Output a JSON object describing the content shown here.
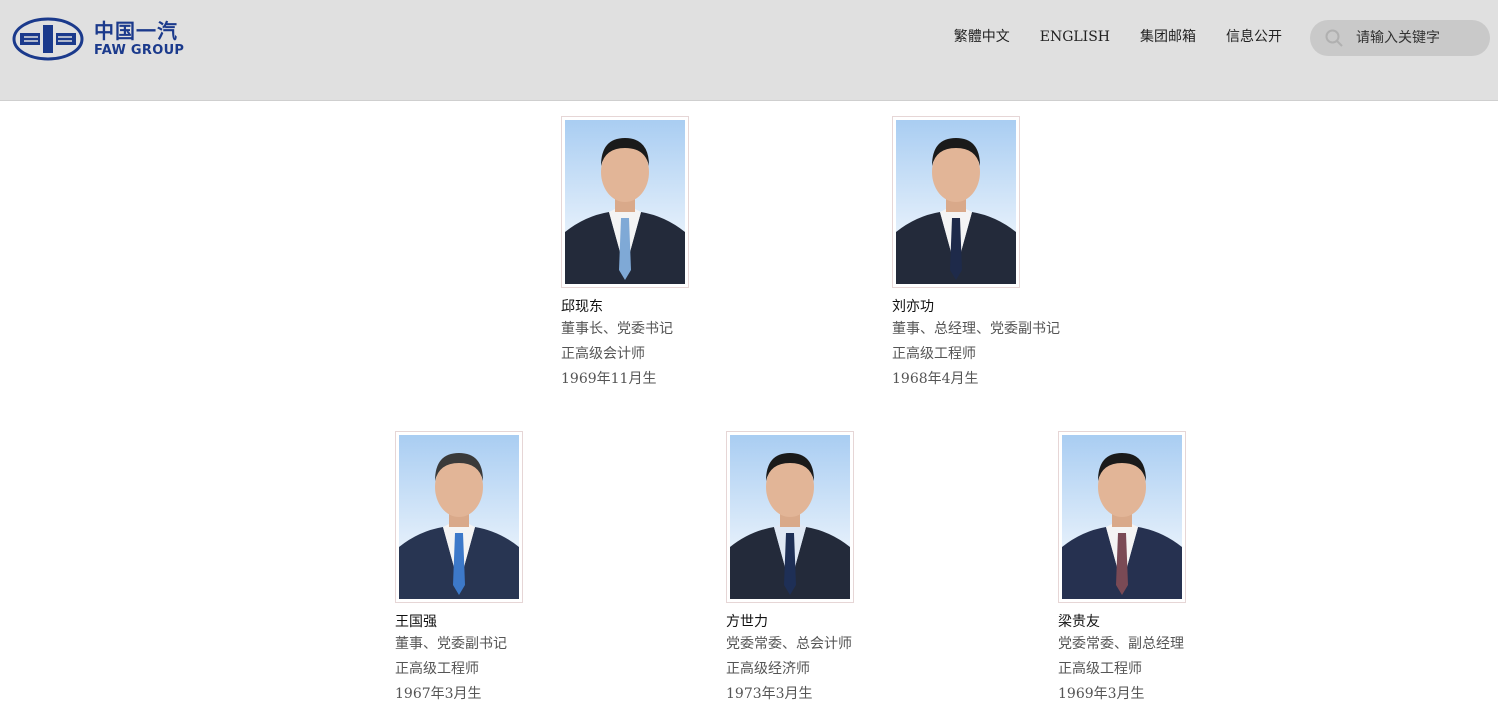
{
  "header": {
    "logo": {
      "cn": "中国一汽",
      "en": "FAW GROUP",
      "brand_color": "#1b3a8c"
    },
    "nav": [
      {
        "label": "繁體中文"
      },
      {
        "label": "ENGLISH"
      },
      {
        "label": "集团邮箱"
      },
      {
        "label": "信息公开"
      }
    ],
    "search": {
      "placeholder": "请输入关键字",
      "icon": "search-icon"
    }
  },
  "leaders": [
    {
      "name": "邱现东",
      "title": "董事长、党委书记",
      "rank": "正高级会计师",
      "born": "1969年11月生",
      "tie_color": "#7fa9d6"
    },
    {
      "name": "刘亦功",
      "title": "董事、总经理、党委副书记",
      "rank": "正高级工程师",
      "born": "1968年4月生",
      "tie_color": "#1e2a4a"
    },
    {
      "name": "王国强",
      "title": "董事、党委副书记",
      "rank": "正高级工程师",
      "born": "1967年3月生",
      "tie_color": "#3d79c9"
    },
    {
      "name": "方世力",
      "title": "党委常委、总会计师",
      "rank": "正高级经济师",
      "born": "1973年3月生",
      "tie_color": "#1e2f56"
    },
    {
      "name": "梁贵友",
      "title": "党委常委、副总经理",
      "rank": "正高级工程师",
      "born": "1969年3月生",
      "tie_color": "#7a4a55"
    }
  ]
}
